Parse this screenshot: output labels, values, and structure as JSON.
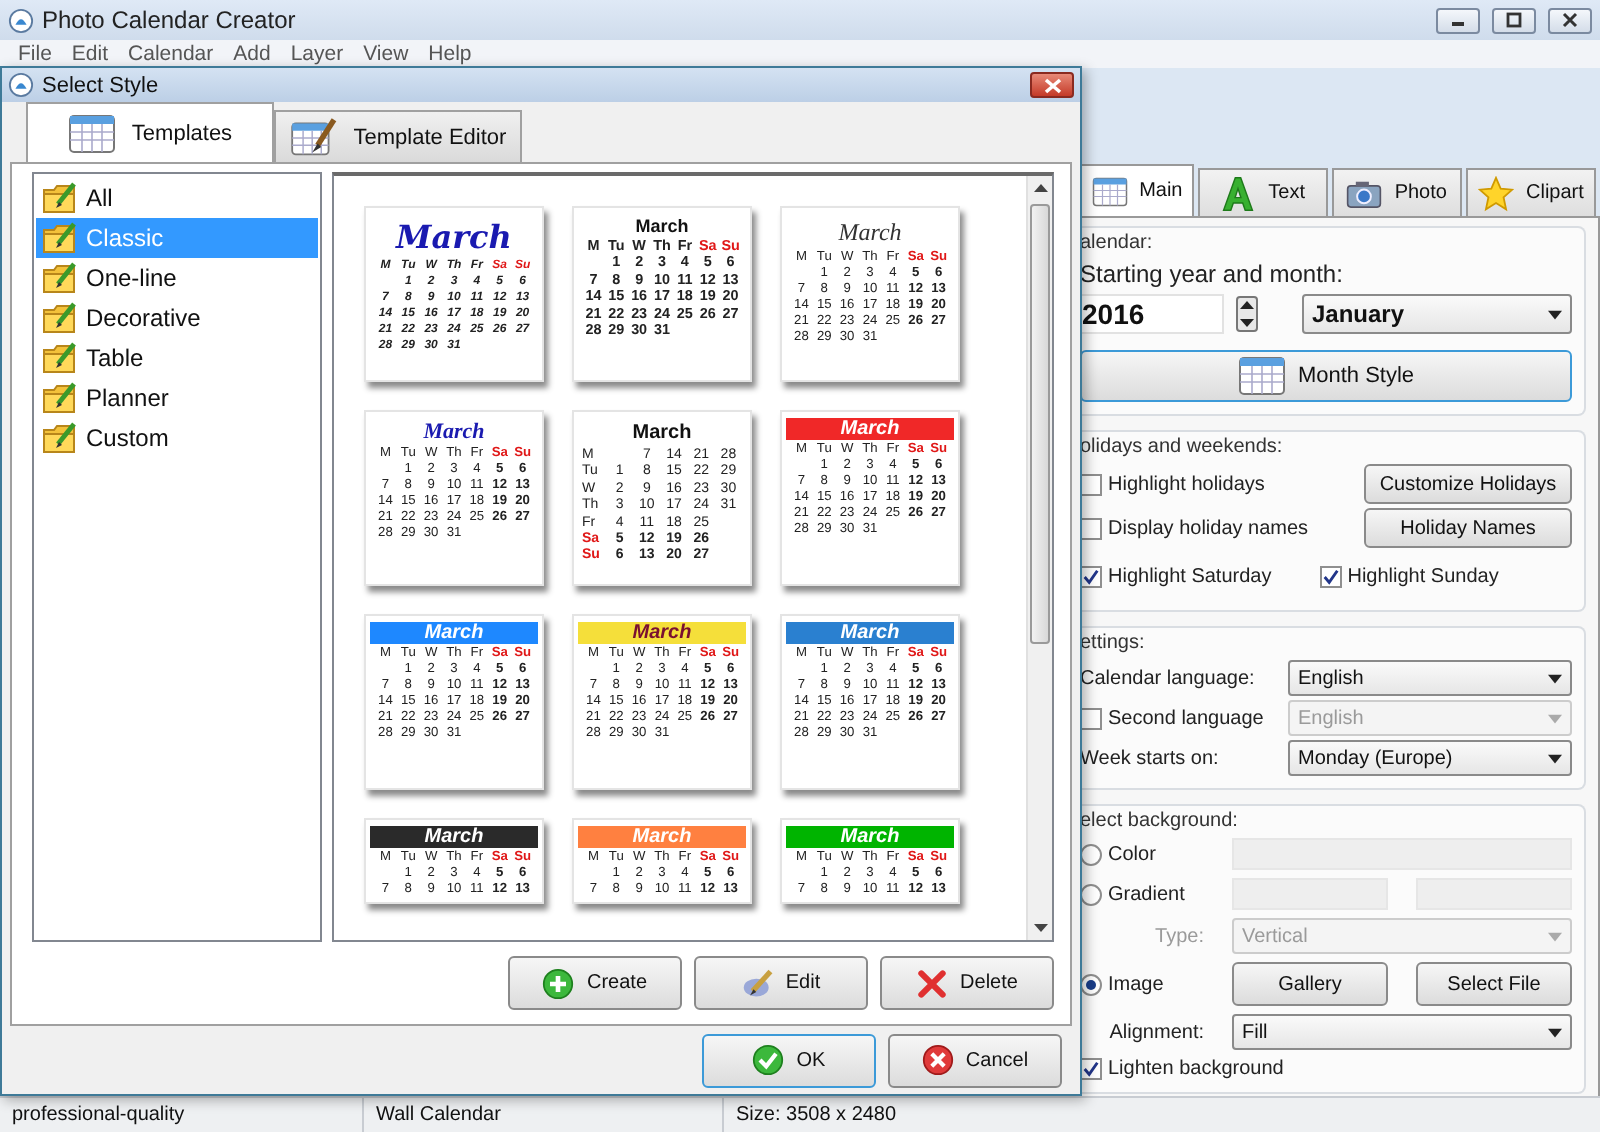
{
  "app": {
    "title": "Photo Calendar Creator"
  },
  "menu": [
    "File",
    "Edit",
    "Calendar",
    "Add",
    "Layer",
    "View",
    "Help"
  ],
  "dialog": {
    "title": "Select Style",
    "tabs": [
      {
        "label": "Templates",
        "selected": true,
        "kind": "grid"
      },
      {
        "label": "Template Editor",
        "selected": false,
        "kind": "editor"
      }
    ],
    "categories": [
      {
        "label": "All",
        "selected": false
      },
      {
        "label": "Classic",
        "selected": true
      },
      {
        "label": "One-line",
        "selected": false
      },
      {
        "label": "Decorative",
        "selected": false
      },
      {
        "label": "Table",
        "selected": false
      },
      {
        "label": "Planner",
        "selected": false
      },
      {
        "label": "Custom",
        "selected": false
      }
    ],
    "templates": [
      {
        "kind": "flourish",
        "title": "March",
        "weekdays": [
          "M",
          "Tu",
          "W",
          "Th",
          "Fr",
          "Sa",
          "Su"
        ],
        "weeks": [
          [
            "1",
            "2",
            "3",
            "4",
            "5",
            "6"
          ],
          [
            "7",
            "8",
            "9",
            "10",
            "11",
            "12",
            "13"
          ],
          [
            "14",
            "15",
            "16",
            "17",
            "18",
            "19",
            "20"
          ],
          [
            "21",
            "22",
            "23",
            "24",
            "25",
            "26",
            "27"
          ],
          [
            "28",
            "29",
            "30",
            "31"
          ]
        ]
      },
      {
        "kind": "bold",
        "title": "March",
        "weekdays": [
          "M",
          "Tu",
          "W",
          "Th",
          "Fr",
          "Sa",
          "Su"
        ],
        "weeks": [
          [
            "1",
            "2",
            "3",
            "4",
            "5",
            "6"
          ],
          [
            "7",
            "8",
            "9",
            "10",
            "11",
            "12",
            "13"
          ],
          [
            "14",
            "15",
            "16",
            "17",
            "18",
            "19",
            "20"
          ],
          [
            "21",
            "22",
            "23",
            "24",
            "25",
            "26",
            "27"
          ],
          [
            "28",
            "29",
            "30",
            "31"
          ]
        ]
      },
      {
        "kind": "engraved",
        "title": "March",
        "weekdays": [
          "M",
          "Tu",
          "W",
          "Th",
          "Fr",
          "Sa",
          "Su"
        ],
        "weeks": [
          [
            "1",
            "2",
            "3",
            "4",
            "5",
            "6"
          ],
          [
            "7",
            "8",
            "9",
            "10",
            "11",
            "12",
            "13"
          ],
          [
            "14",
            "15",
            "16",
            "17",
            "18",
            "19",
            "20"
          ],
          [
            "21",
            "22",
            "23",
            "24",
            "25",
            "26",
            "27"
          ],
          [
            "28",
            "29",
            "30",
            "31"
          ]
        ]
      },
      {
        "kind": "italic",
        "title": "March",
        "weekdays": [
          "M",
          "Tu",
          "W",
          "Th",
          "Fr",
          "Sa",
          "Su"
        ],
        "weeks": [
          [
            "1",
            "2",
            "3",
            "4",
            "5",
            "6"
          ],
          [
            "7",
            "8",
            "9",
            "10",
            "11",
            "12",
            "13"
          ],
          [
            "14",
            "15",
            "16",
            "17",
            "18",
            "19",
            "20"
          ],
          [
            "21",
            "22",
            "23",
            "24",
            "25",
            "26",
            "27"
          ],
          [
            "28",
            "29",
            "30",
            "31"
          ]
        ]
      },
      {
        "kind": "columns",
        "title": "March",
        "weekdays": [
          "M",
          "Tu",
          "W",
          "Th",
          "Fr",
          "Sa",
          "Su"
        ],
        "weeks": [
          [
            "1",
            "2",
            "3",
            "4",
            "5",
            "6"
          ],
          [
            "7",
            "8",
            "9",
            "10",
            "11",
            "12",
            "13"
          ],
          [
            "14",
            "15",
            "16",
            "17",
            "18",
            "19",
            "20"
          ],
          [
            "21",
            "22",
            "23",
            "24",
            "25",
            "26",
            "27"
          ],
          [
            "28",
            "29",
            "30",
            "31"
          ]
        ]
      },
      {
        "kind": "banner",
        "color": "#f02828",
        "title": "March",
        "weekdays": [
          "M",
          "Tu",
          "W",
          "Th",
          "Fr",
          "Sa",
          "Su"
        ],
        "weeks": [
          [
            "1",
            "2",
            "3",
            "4",
            "5",
            "6"
          ],
          [
            "7",
            "8",
            "9",
            "10",
            "11",
            "12",
            "13"
          ],
          [
            "14",
            "15",
            "16",
            "17",
            "18",
            "19",
            "20"
          ],
          [
            "21",
            "22",
            "23",
            "24",
            "25",
            "26",
            "27"
          ],
          [
            "28",
            "29",
            "30",
            "31"
          ]
        ]
      },
      {
        "kind": "banner",
        "color": "#1e88ff",
        "title": "March",
        "weekdays": [
          "M",
          "Tu",
          "W",
          "Th",
          "Fr",
          "Sa",
          "Su"
        ],
        "weeks": [
          [
            "1",
            "2",
            "3",
            "4",
            "5",
            "6"
          ],
          [
            "7",
            "8",
            "9",
            "10",
            "11",
            "12",
            "13"
          ],
          [
            "14",
            "15",
            "16",
            "17",
            "18",
            "19",
            "20"
          ],
          [
            "21",
            "22",
            "23",
            "24",
            "25",
            "26",
            "27"
          ],
          [
            "28",
            "29",
            "30",
            "31"
          ]
        ]
      },
      {
        "kind": "banner",
        "color": "#f5df3a",
        "title": "March",
        "weekdays": [
          "M",
          "Tu",
          "W",
          "Th",
          "Fr",
          "Sa",
          "Su"
        ],
        "weeks": [
          [
            "1",
            "2",
            "3",
            "4",
            "5",
            "6"
          ],
          [
            "7",
            "8",
            "9",
            "10",
            "11",
            "12",
            "13"
          ],
          [
            "14",
            "15",
            "16",
            "17",
            "18",
            "19",
            "20"
          ],
          [
            "21",
            "22",
            "23",
            "24",
            "25",
            "26",
            "27"
          ],
          [
            "28",
            "29",
            "30",
            "31"
          ]
        ]
      },
      {
        "kind": "banner",
        "color": "#2a80d0",
        "title": "March",
        "weekdays": [
          "M",
          "Tu",
          "W",
          "Th",
          "Fr",
          "Sa",
          "Su"
        ],
        "weeks": [
          [
            "1",
            "2",
            "3",
            "4",
            "5",
            "6"
          ],
          [
            "7",
            "8",
            "9",
            "10",
            "11",
            "12",
            "13"
          ],
          [
            "14",
            "15",
            "16",
            "17",
            "18",
            "19",
            "20"
          ],
          [
            "21",
            "22",
            "23",
            "24",
            "25",
            "26",
            "27"
          ],
          [
            "28",
            "29",
            "30",
            "31"
          ]
        ]
      },
      {
        "kind": "banner",
        "color": "#2a2a2a",
        "title": "March",
        "weekdays": [
          "M",
          "Tu",
          "W",
          "Th",
          "Fr",
          "Sa",
          "Su"
        ],
        "weeks": [
          [
            "1",
            "2",
            "3",
            "4",
            "5",
            "6"
          ],
          [
            "7",
            "8",
            "9",
            "10",
            "11",
            "12",
            "13"
          ]
        ]
      },
      {
        "kind": "banner",
        "color": "#ff8040",
        "title": "March",
        "weekdays": [
          "M",
          "Tu",
          "W",
          "Th",
          "Fr",
          "Sa",
          "Su"
        ],
        "weeks": [
          [
            "1",
            "2",
            "3",
            "4",
            "5",
            "6"
          ],
          [
            "7",
            "8",
            "9",
            "10",
            "11",
            "12",
            "13"
          ]
        ]
      },
      {
        "kind": "banner",
        "color": "#00b400",
        "title": "March",
        "weekdays": [
          "M",
          "Tu",
          "W",
          "Th",
          "Fr",
          "Sa",
          "Su"
        ],
        "weeks": [
          [
            "1",
            "2",
            "3",
            "4",
            "5",
            "6"
          ],
          [
            "7",
            "8",
            "9",
            "10",
            "11",
            "12",
            "13"
          ]
        ]
      }
    ],
    "actions": [
      {
        "label": "Create",
        "kind": "create"
      },
      {
        "label": "Edit",
        "kind": "edit"
      },
      {
        "label": "Delete",
        "kind": "delete"
      }
    ],
    "buttons": [
      {
        "label": "OK",
        "kind": "ok"
      },
      {
        "label": "Cancel",
        "kind": "cancel"
      }
    ]
  },
  "panel": {
    "tabs": [
      {
        "label": "Main",
        "selected": true,
        "kind": "main"
      },
      {
        "label": "Text",
        "selected": false,
        "kind": "text"
      },
      {
        "label": "Photo",
        "selected": false,
        "kind": "photo"
      },
      {
        "label": "Clipart",
        "selected": false,
        "kind": "clipart"
      }
    ],
    "calendar": {
      "title": "alendar:",
      "start_label": "Starting year and month:",
      "year": "2016",
      "month": "January",
      "month_style_button": "Month Style"
    },
    "holidays": {
      "title": "olidays and weekends:",
      "options": [
        {
          "label": "Highlight holidays",
          "checked": false
        },
        {
          "label": "Display holiday names",
          "checked": false
        },
        {
          "label": "Highlight Saturday",
          "checked": true
        },
        {
          "label": "Highlight Sunday",
          "checked": true
        }
      ],
      "buttons": [
        "Customize Holidays",
        "Holiday Names"
      ]
    },
    "settings": {
      "title": "ettings:",
      "language_label": "Calendar language:",
      "language": "English",
      "second_language": {
        "label": "Second language",
        "checked": false,
        "value": "English",
        "disabled": true
      },
      "week_start_label": "Week starts on:",
      "week_start": "Monday (Europe)"
    },
    "background": {
      "title": "elect background:",
      "options": [
        {
          "label": "Color",
          "selected": false
        },
        {
          "label": "Gradient",
          "selected": false
        },
        {
          "label": "Image",
          "selected": true
        }
      ],
      "type": {
        "label": "Type:",
        "value": "Vertical",
        "disabled": true
      },
      "buttons": [
        "Gallery",
        "Select File"
      ],
      "alignment_label": "Alignment:",
      "alignment": "Fill",
      "lighten": {
        "label": "Lighten background",
        "checked": true
      }
    }
  },
  "status_bar": [
    "professional-quality",
    "Wall Calendar",
    "Size: 3508 x 2480"
  ]
}
